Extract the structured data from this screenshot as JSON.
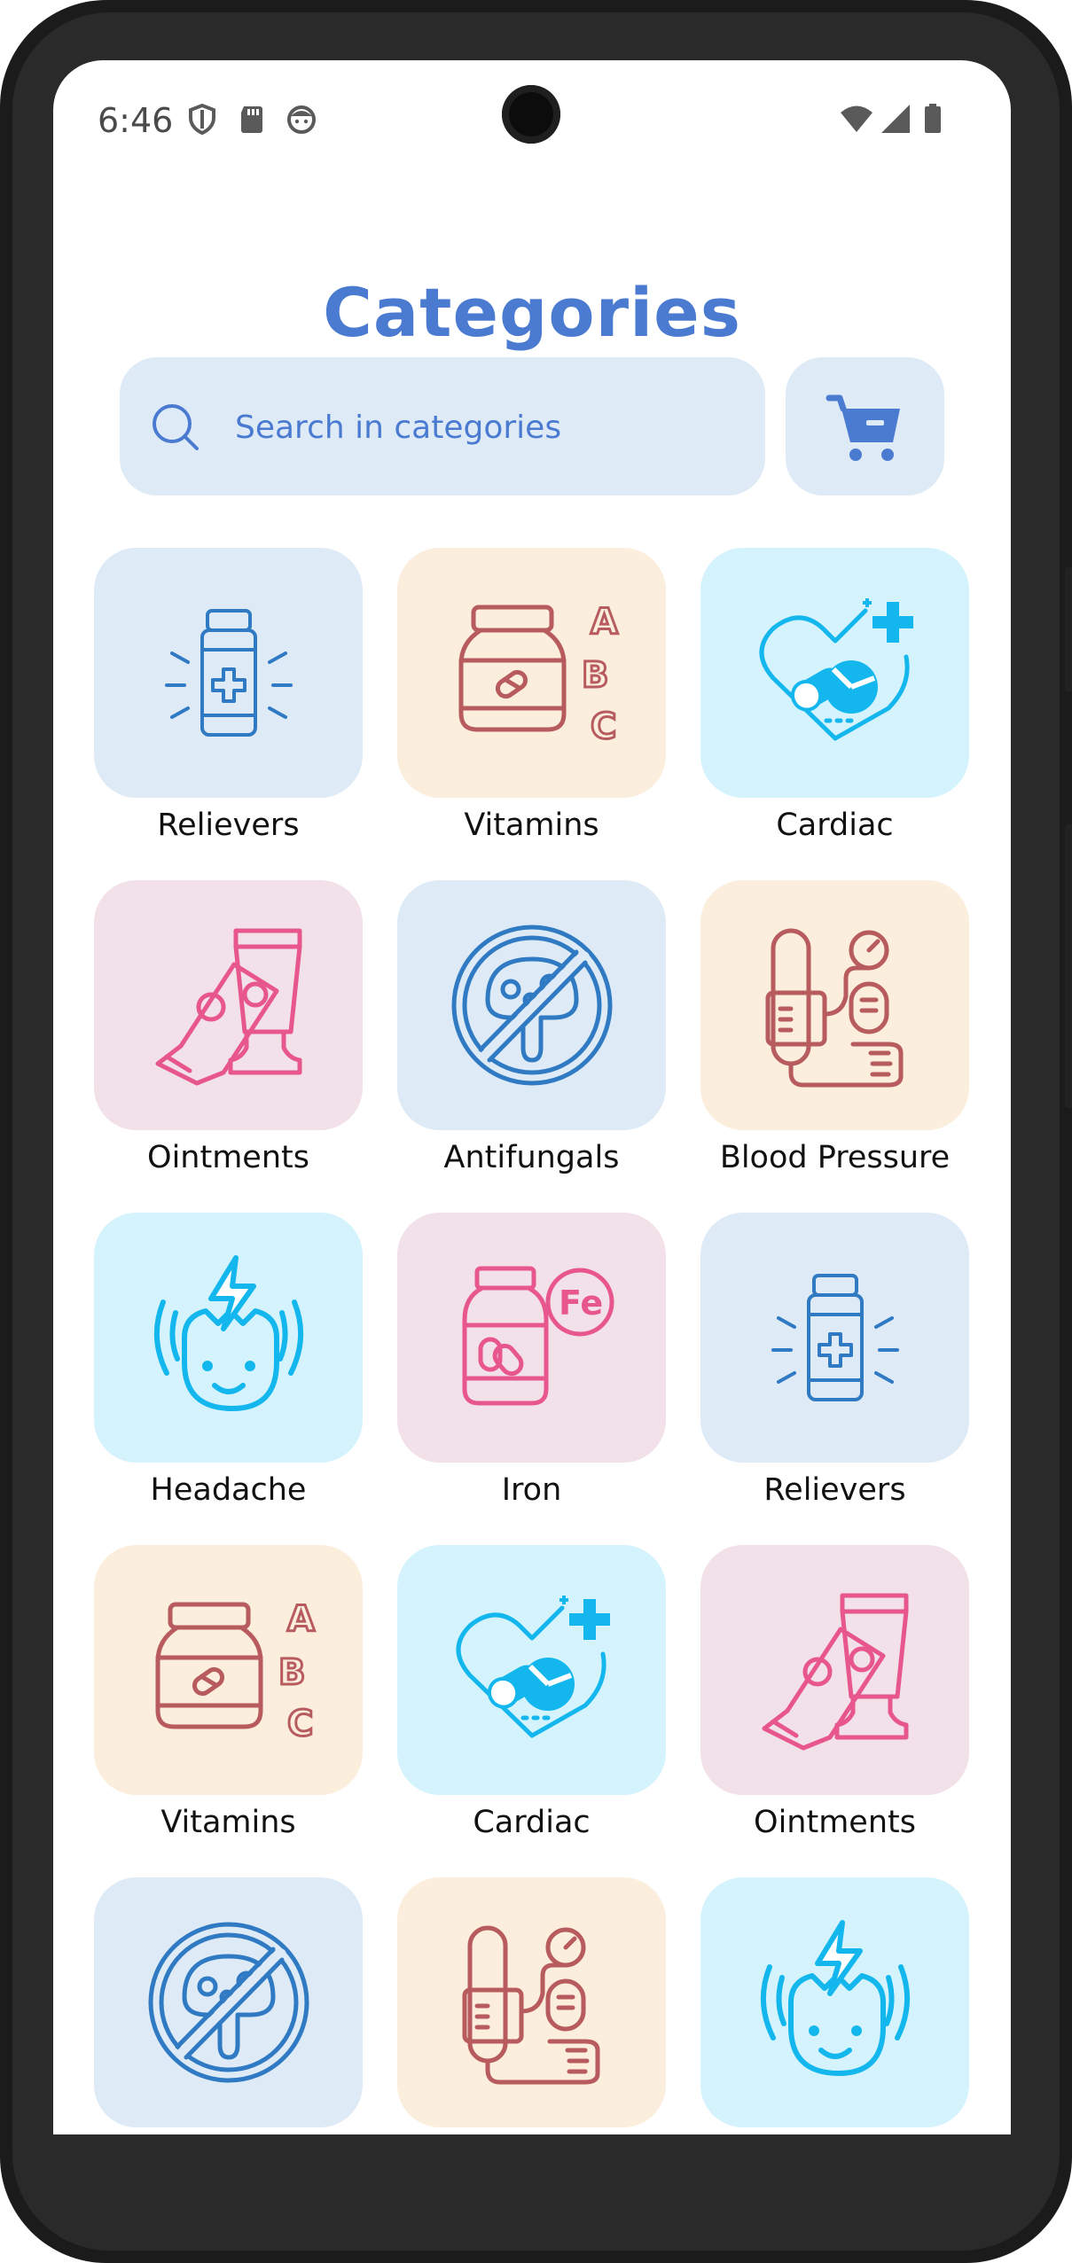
{
  "status_bar": {
    "time": "6:46",
    "left_icons": [
      "shield-icon",
      "sd-card-icon",
      "face-icon"
    ],
    "right_icons": [
      "wifi-icon",
      "signal-icon",
      "battery-icon"
    ]
  },
  "header": {
    "title": "Categories"
  },
  "search": {
    "placeholder": "Search in categories",
    "value": ""
  },
  "colors": {
    "accent": "#4a7bd1",
    "tile_blue": "#deebf7",
    "tile_beige": "#fbeedd",
    "tile_cyan": "#d4f3fd",
    "tile_pink": "#f2e1e8",
    "icon_blue": "#2f7ac2",
    "icon_red": "#b85b5e",
    "icon_cyan": "#13b7ee",
    "icon_pink": "#e8568e"
  },
  "categories": [
    {
      "label": "Relievers",
      "icon": "pill-bottle-icon",
      "tile": "#deebf7"
    },
    {
      "label": "Vitamins",
      "icon": "vitamin-jar-icon",
      "tile": "#fbeedd"
    },
    {
      "label": "Cardiac",
      "icon": "heart-pill-icon",
      "tile": "#d4f3fd"
    },
    {
      "label": "Ointments",
      "icon": "ointment-tube-icon",
      "tile": "#f2e1e8"
    },
    {
      "label": "Antifungals",
      "icon": "no-fungus-icon",
      "tile": "#deebf7"
    },
    {
      "label": "Blood Pressure",
      "icon": "blood-pressure-cuff-icon",
      "tile": "#fbeedd"
    },
    {
      "label": "Headache",
      "icon": "headache-face-icon",
      "tile": "#d4f3fd"
    },
    {
      "label": "Iron",
      "icon": "iron-supplement-icon",
      "tile": "#f2e1e8"
    },
    {
      "label": "Relievers",
      "icon": "pill-bottle-icon",
      "tile": "#deebf7"
    },
    {
      "label": "Vitamins",
      "icon": "vitamin-jar-icon",
      "tile": "#fbeedd"
    },
    {
      "label": "Cardiac",
      "icon": "heart-pill-icon",
      "tile": "#d4f3fd"
    },
    {
      "label": "Ointments",
      "icon": "ointment-tube-icon",
      "tile": "#f2e1e8"
    },
    {
      "label": "",
      "icon": "no-fungus-icon",
      "tile": "#deebf7"
    },
    {
      "label": "",
      "icon": "blood-pressure-cuff-icon",
      "tile": "#fbeedd"
    },
    {
      "label": "",
      "icon": "headache-face-icon",
      "tile": "#d4f3fd"
    }
  ]
}
